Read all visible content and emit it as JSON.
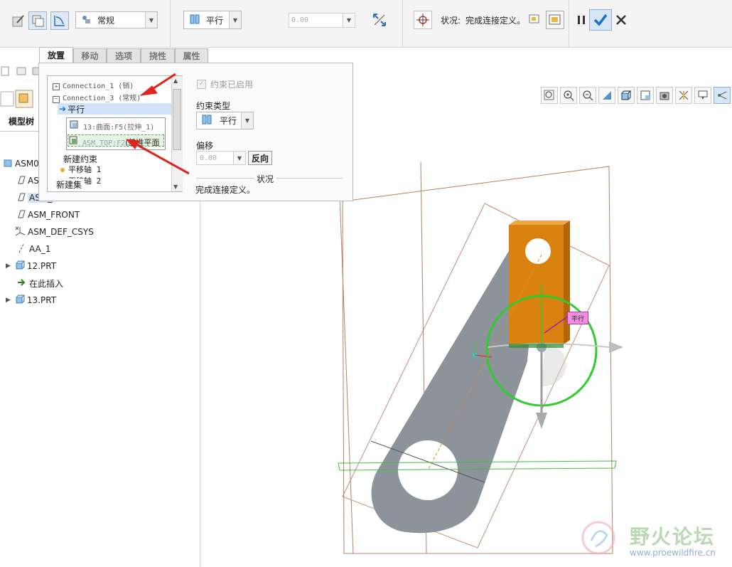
{
  "dashboard": {
    "mode_combo": {
      "value": "常规"
    },
    "constraint_combo": {
      "value": "平行"
    },
    "offset_combo": {
      "value": "0.00"
    },
    "status_label": "状况:",
    "status_text": "完成连接定义。"
  },
  "tabs": [
    {
      "label": "放置"
    },
    {
      "label": "移动"
    },
    {
      "label": "选项"
    },
    {
      "label": "挠性"
    },
    {
      "label": "属性"
    }
  ],
  "placement": {
    "tree": {
      "connection_1": "Connection_1 (销)",
      "connection_3": "Connection_3 (常规)",
      "constraint": "平行",
      "ref_1": "13:曲面:F5(拉伸_1)",
      "ref_2_code": "ASM_TOP:F2",
      "ref_2_suffix": "(基准平面",
      "new_constraint": "新建约束",
      "axis_1": "平移轴 1",
      "axis_2": "平移轴 2",
      "new_set": "新建集"
    },
    "enabled_label": "约束已启用",
    "constraint_type_label": "约束类型",
    "constraint_type_value": "平行",
    "offset_label": "偏移",
    "offset_value": "0.00",
    "flip_button": "反向",
    "status_heading": "状况",
    "status_text": "完成连接定义。"
  },
  "model_tree": {
    "tab_label": "模型树",
    "items": [
      {
        "label": "ASM0"
      },
      {
        "label": "ASM_"
      },
      {
        "label": "ASM_"
      },
      {
        "label": "ASM_FRONT"
      },
      {
        "label": "ASM_DEF_CSYS"
      },
      {
        "label": "AA_1"
      },
      {
        "label": "12.PRT"
      },
      {
        "label": "在此插入"
      },
      {
        "label": "13.PRT"
      }
    ]
  },
  "viewport": {
    "tag_label": "平行"
  },
  "watermark": {
    "name": "野火论坛",
    "url": "www.proewildfire.cn"
  },
  "colors": {
    "accent": "#1e6fc8",
    "selection": "#cfe4fb",
    "part_orange": "#d9820f",
    "part_gray": "#8c939b",
    "tag_pink": "#f08ee0",
    "arrow_red": "#e0231b",
    "ring_green": "#2ecc2e"
  },
  "icons": [
    "regenerate-icon",
    "copy-icon",
    "sketch-icon",
    "assembly-icon",
    "parallel-icon",
    "flip-icon",
    "move-icon",
    "window-icon",
    "pause-icon",
    "check-icon",
    "close-icon"
  ]
}
